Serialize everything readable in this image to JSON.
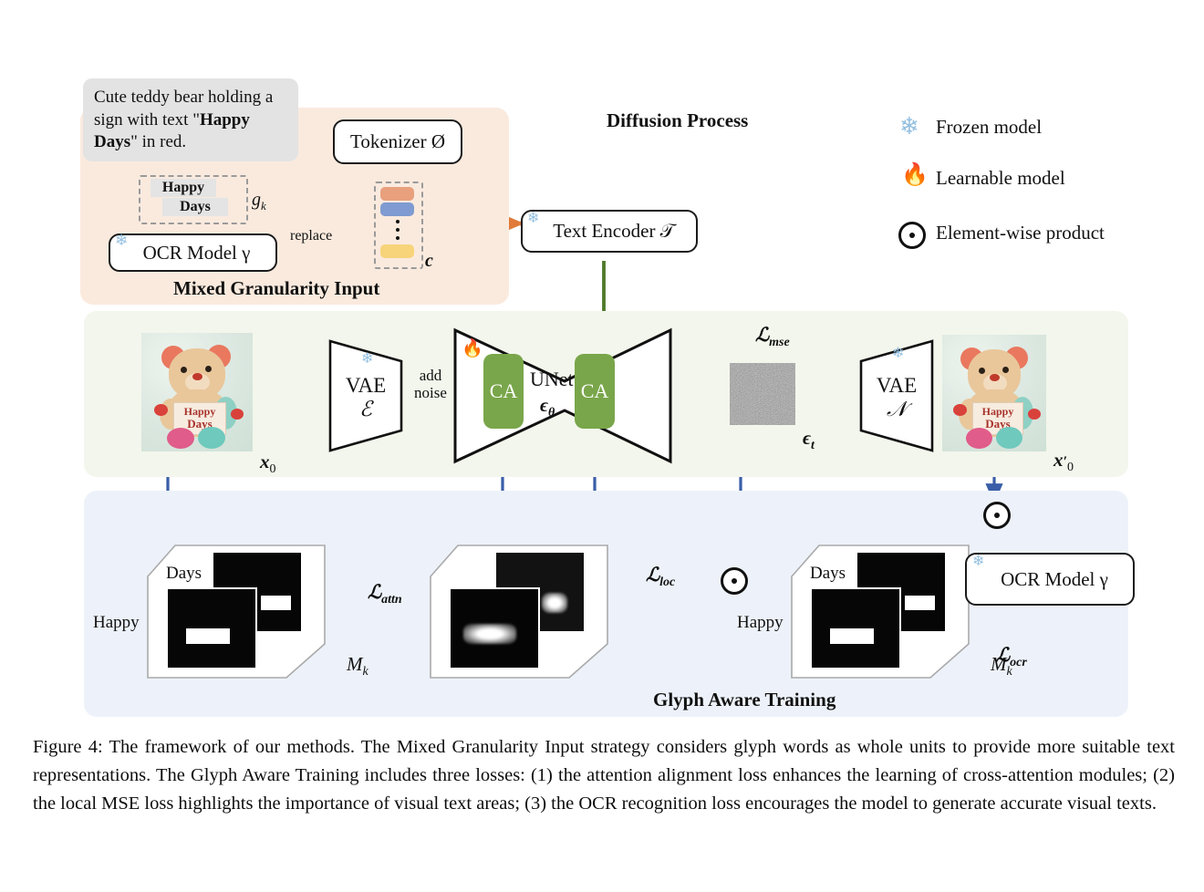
{
  "figure": {
    "caption": "Figure 4: The framework of our methods. The Mixed Granularity Input strategy considers glyph words as whole units to provide more suitable text representations. The Glyph Aware Training includes three losses: (1) the attention alignment loss enhances the learning of cross-attention modules; (2) the local MSE loss highlights the importance of visual text areas; (3) the OCR recognition loss encourages the model to generate accurate visual texts."
  },
  "colors": {
    "mgi_panel": "#faeade",
    "diffusion_panel": "#f3f6ec",
    "glyph_panel": "#edf2fa",
    "orange_arrow": "#e07b39",
    "green_arrow": "#4f7a2a",
    "blue_arrow": "#3a5ea8",
    "ca_block": "#79a64a",
    "token_orange": "#e8a07d",
    "token_blue": "#7f9bd1",
    "token_yellow": "#f7d47a"
  },
  "mixed_granularity": {
    "title": "Mixed Granularity Input",
    "prompt_part1": "Cute teddy bear holding a sign with text \"",
    "prompt_bold": "Happy Days",
    "prompt_part2": "\" in red.",
    "glyph_words": [
      "Happy",
      "Days"
    ],
    "glyph_symbol": "g",
    "glyph_subscript": "k",
    "ocr_model": "OCR Model γ",
    "tokenizer": "Tokenizer Ø",
    "replace_label": "replace",
    "condition_symbol": "c"
  },
  "diffusion": {
    "title": "Diffusion Process",
    "text_encoder": "Text Encoder 𝒯",
    "vae_encoder_name": "VAE",
    "vae_encoder_symbol": "ℰ",
    "vae_decoder_name": "VAE",
    "vae_decoder_symbol": "𝒩",
    "add_noise_line1": "add",
    "add_noise_line2": "noise",
    "unet_name": "UNet",
    "unet_symbol": "ϵ",
    "unet_subscript": "θ",
    "ca_left": "CA",
    "ca_right": "CA",
    "input_image_symbol": "x",
    "input_image_subscript": "0",
    "output_image_symbol": "x",
    "output_image_subscript": "0",
    "noise_symbol": "ϵ",
    "noise_subscript": "t",
    "loss_mse": "ℒ",
    "loss_mse_sub": "mse",
    "image_sign_line1": "Happy",
    "image_sign_line2": "Days"
  },
  "glyph_training": {
    "title": "Glyph Aware Training",
    "mask_symbol": "M",
    "mask_subscript": "k",
    "word_top": "Days",
    "word_bottom": "Happy",
    "loss_attn": "ℒ",
    "loss_attn_sub": "attn",
    "loss_loc": "ℒ",
    "loss_loc_sub": "loc",
    "loss_ocr": "ℒ",
    "loss_ocr_sub": "ocr",
    "ocr_model": "OCR Model γ"
  },
  "legend": {
    "items": [
      {
        "icon": "snowflake-icon",
        "label": "Frozen model"
      },
      {
        "icon": "flame-icon",
        "label": "Learnable model"
      },
      {
        "icon": "element-wise-product-icon",
        "label": "Element-wise product"
      }
    ]
  }
}
